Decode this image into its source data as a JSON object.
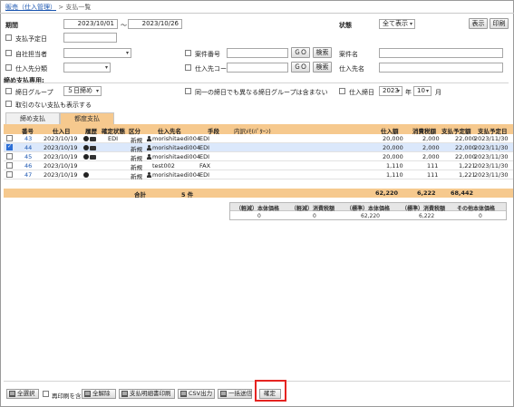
{
  "breadcrumb": {
    "parent": "販売（仕入管理）",
    "sep": ">",
    "current": "支払一覧"
  },
  "filters": {
    "period_label": "期間",
    "date_from": "2023/10/01",
    "tilde": "～",
    "date_to": "2023/10/26",
    "status_label": "状態",
    "status_value": "全て表示",
    "display_button": "表示",
    "print_button": "印刷",
    "pay_date_label": "支払予定日",
    "own_staff_label": "自社担当者",
    "case_no_label": "案件番号",
    "case_name_label": "案件名",
    "supplier_cat_label": "仕入先分類",
    "supplier_code_label": "仕入先コード",
    "supplier_name_label": "仕入先名",
    "go_label": "ＧＯ",
    "search_label": "検索",
    "closing_section_label": "締め支払専用:",
    "closing_group_label": "締日グループ",
    "closing_group_value": "５日締め",
    "same_group_label": "同一の締日でも異なる締日グループは含まない",
    "purchase_closing_label": "仕入締日",
    "year_value": "2023",
    "year_unit": "年",
    "month_value": "10",
    "month_unit": "月",
    "no_transaction_label": "取引のない支払も表示する"
  },
  "tabs": [
    {
      "label": "締め支払",
      "active": false
    },
    {
      "label": "都度支払",
      "active": true
    }
  ],
  "table": {
    "headers": [
      "番号",
      "仕入日",
      "履歴",
      "確定状態",
      "区分",
      "仕入先名",
      "手段",
      "内訳ﾒﾓ(ﾊﾟﾀｰﾝ)",
      "仕入額",
      "消費税額",
      "支払予定額",
      "支払予定日"
    ],
    "rows": [
      {
        "checked": false,
        "no": "43",
        "date": "2023/10/19",
        "icons": "circle-print",
        "confirm": "EDI",
        "kubun": "新規",
        "supplier": "morishitaedi004",
        "person": true,
        "method": "EDI",
        "memo": "",
        "amount": "20,000",
        "tax": "2,000",
        "pay": "22,000",
        "pay_date": "2023/11/30"
      },
      {
        "checked": true,
        "no": "44",
        "date": "2023/10/19",
        "icons": "circle-print",
        "confirm": "",
        "kubun": "新規",
        "supplier": "morishitaedi004",
        "person": true,
        "method": "EDI",
        "memo": "",
        "amount": "20,000",
        "tax": "2,000",
        "pay": "22,000",
        "pay_date": "2023/11/30"
      },
      {
        "checked": false,
        "no": "45",
        "date": "2023/10/19",
        "icons": "circle-print",
        "confirm": "",
        "kubun": "新規",
        "supplier": "morishitaedi004",
        "person": true,
        "method": "EDI",
        "memo": "",
        "amount": "20,000",
        "tax": "2,000",
        "pay": "22,000",
        "pay_date": "2023/11/30"
      },
      {
        "checked": false,
        "no": "46",
        "date": "2023/10/19",
        "icons": "",
        "confirm": "",
        "kubun": "新規",
        "supplier": "test002",
        "person": false,
        "method": "FAX",
        "memo": "",
        "amount": "1,110",
        "tax": "111",
        "pay": "1,221",
        "pay_date": "2023/11/30"
      },
      {
        "checked": false,
        "no": "47",
        "date": "2023/10/19",
        "icons": "circle",
        "confirm": "",
        "kubun": "新規",
        "supplier": "morishitaedi004",
        "person": true,
        "method": "EDI",
        "memo": "",
        "amount": "1,110",
        "tax": "111",
        "pay": "1,221",
        "pay_date": "2023/11/30"
      }
    ]
  },
  "totals": {
    "label": "合計",
    "count": "5 件",
    "amount": "62,220",
    "tax": "6,222",
    "pay": "68,442"
  },
  "summary": {
    "headers": [
      "（軽減）本体価格",
      "（軽減）消費税額",
      "（標準）本体価格",
      "（標準）消費税額",
      "その他本体価格"
    ],
    "values": [
      "0",
      "0",
      "62,220",
      "6,222",
      "0"
    ]
  },
  "footer": {
    "select_all": "全選択",
    "include_repay": "再印刷を含む",
    "deselect_all": "全解除",
    "print_statement": "支払明細書印刷",
    "csv_output": "CSV出力",
    "bulk_send": "一括送信",
    "confirm": "確定"
  },
  "colors": {
    "accent_orange": "#f6c98e",
    "selected_row": "#dbe8fb",
    "highlight_red": "#e52421",
    "link_blue": "#1a55b0"
  }
}
